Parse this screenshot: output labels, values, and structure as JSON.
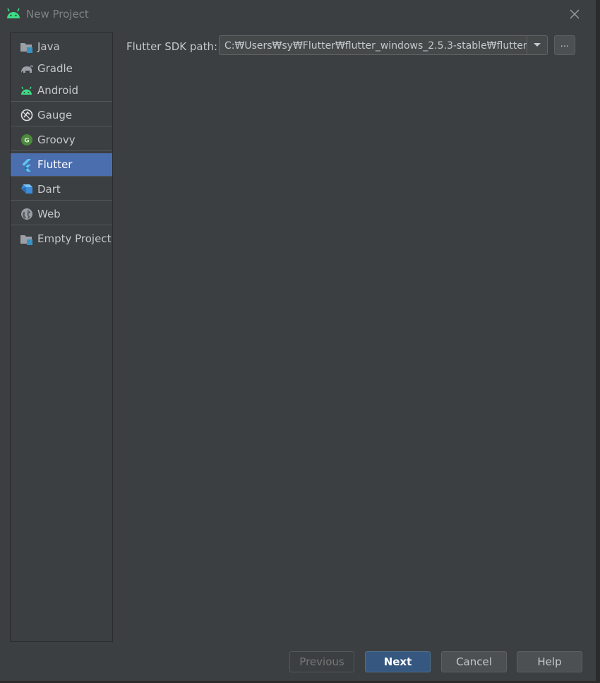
{
  "window": {
    "title": "New Project",
    "app_icon": "android-icon",
    "close_icon": "close-icon",
    "colors": {
      "background": "#3c3f41",
      "selection": "#4b6eaf",
      "primary_button": "#365880"
    }
  },
  "sidebar": {
    "items": [
      {
        "label": "Java",
        "icon": "java-folder-icon"
      },
      {
        "label": "Gradle",
        "icon": "gradle-elephant-icon"
      },
      {
        "label": "Android",
        "icon": "android-icon"
      },
      {
        "label": "Gauge",
        "icon": "gauge-icon"
      },
      {
        "label": "Groovy",
        "icon": "groovy-icon"
      },
      {
        "label": "Flutter",
        "icon": "flutter-icon",
        "selected": true
      },
      {
        "label": "Dart",
        "icon": "dart-icon"
      },
      {
        "label": "Web",
        "icon": "web-globe-icon"
      },
      {
        "label": "Empty Project",
        "icon": "empty-project-folder-icon"
      }
    ]
  },
  "main": {
    "sdk_label": "Flutter SDK path:",
    "sdk_path": "C:₩Users₩sy₩Flutter₩flutter_windows_2.5.3-stable₩flutter",
    "browse_label": "...",
    "dropdown_icon": "chevron-down-icon"
  },
  "footer": {
    "previous": "Previous",
    "next": "Next",
    "cancel": "Cancel",
    "help": "Help"
  }
}
